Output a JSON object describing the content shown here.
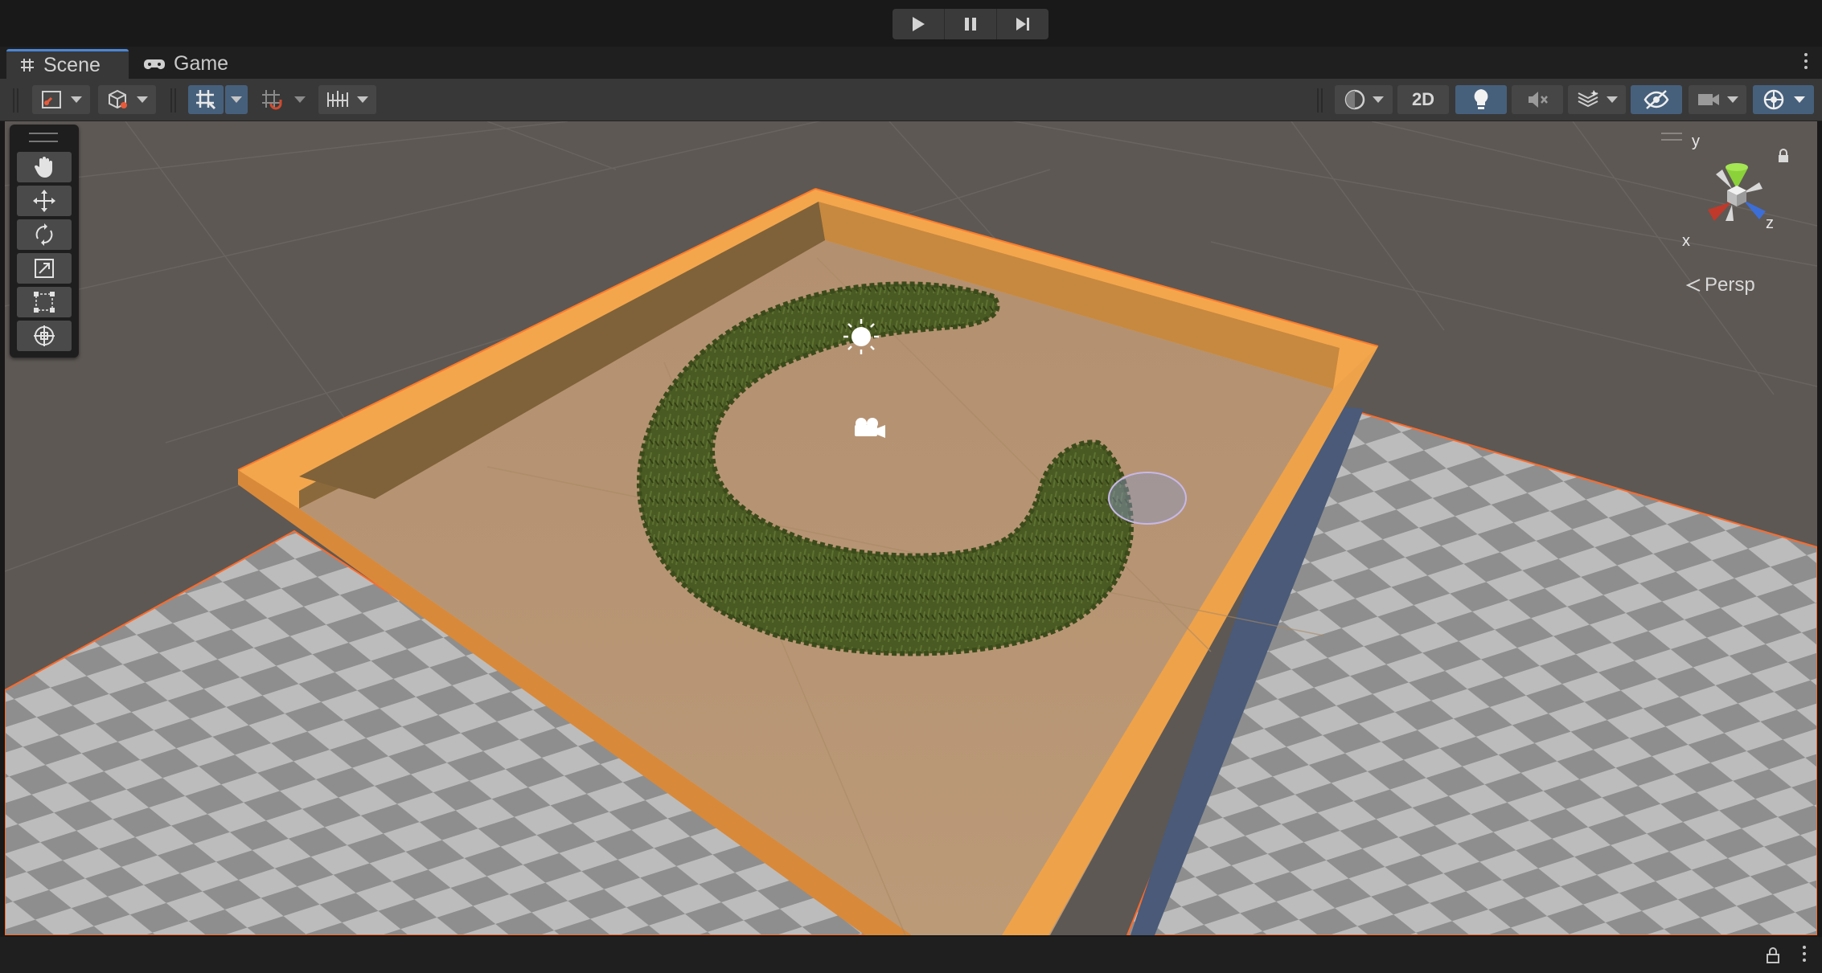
{
  "playmode": {
    "play": "play-icon",
    "pause": "pause-icon",
    "step": "step-icon"
  },
  "tabs": [
    {
      "label": "Scene",
      "icon": "grid-hash-icon",
      "active": true
    },
    {
      "label": "Game",
      "icon": "gamepad-icon",
      "active": false
    }
  ],
  "toolbar": {
    "left": [
      "draw-mode-icon",
      "shading-cube-icon",
      "grid-snap-icon",
      "increment-snap-icon",
      "ruler-icon"
    ],
    "toggle_2d_label": "2D",
    "right": [
      "render-mode-icon",
      "lighting-icon",
      "audio-mute-icon",
      "effects-icon",
      "scene-visibility-icon",
      "camera-icon",
      "gizmos-icon"
    ]
  },
  "tools": [
    "hand-tool",
    "move-tool",
    "rotate-tool",
    "scale-tool",
    "rect-tool",
    "transform-tool"
  ],
  "gizmo": {
    "x_label": "x",
    "y_label": "y",
    "z_label": "z",
    "projection_label": "Persp"
  },
  "colors": {
    "selection_outline": "#f4a64c",
    "grass": "#4a5a23",
    "ground": "#b79873",
    "checker_light": "#bcbcbc",
    "checker_dark": "#8c8c8c",
    "active_button": "#46607c",
    "tab_highlight": "#4c86d6"
  }
}
